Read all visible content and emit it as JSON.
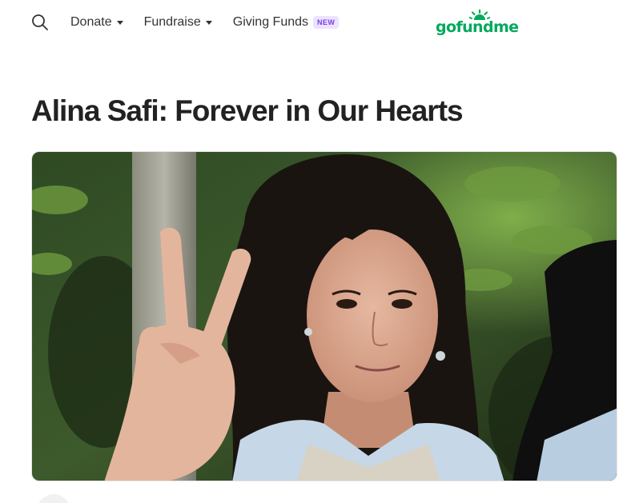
{
  "header": {
    "search_icon": "search-icon",
    "nav": [
      {
        "label": "Donate",
        "has_menu": true
      },
      {
        "label": "Fundraise",
        "has_menu": true
      },
      {
        "label": "Giving Funds",
        "badge": "NEW"
      }
    ],
    "logo_text": "gofundme"
  },
  "campaign": {
    "title": "Alina Safi: Forever in Our Hearts",
    "hero_image": "Photo of a smiling girl with long dark hair making a peace sign, trees in the background"
  },
  "colors": {
    "brand_green": "#02a95c",
    "badge_bg": "#ece3ff",
    "badge_text": "#7a3ee6",
    "text": "#333333"
  }
}
